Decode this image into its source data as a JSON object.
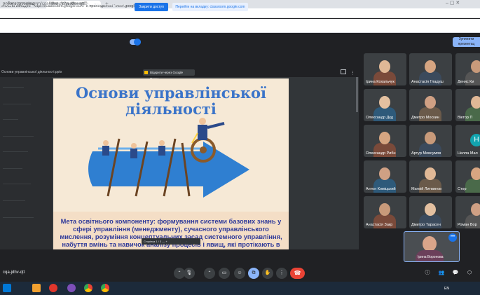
{
  "browser": {
    "tabs": [
      {
        "label": "робота для курсу"
      },
      {
        "label": "Meet. \"cqa-jdhv-qtt\""
      }
    ],
    "url": "meet.google.com/cqa-jdhv-qtt?authuser=0"
  },
  "infobar": {
    "text": "спільна вкладок: \"https://classroom.google.com\" в прилюдженні \"meet.google.com\"",
    "share_label": "Закрити доступ",
    "tab_link_label": "Перейти на вкладку: classroom.google.com"
  },
  "meet": {
    "presenter": "Ірина Воронова (Ви (показуєте презентацію))",
    "sound_label": "Звук презентації",
    "stop_label": "Зупинити презентац",
    "meeting_code": "cqa-jdhv-qtt"
  },
  "presentation": {
    "file_title": "Основи управлінської діяльності.pptx",
    "drive_badge": "Відкрити через Google Презе..."
  },
  "slide": {
    "title_line1": "Основи управлінської",
    "title_line2": "діяльності",
    "body": "Мета освітнього компоненту: формування системи базових знань у сфері управління (менеджменту), сучасного управлінського мислення, розуміння концептуальних засад системного управління, набуття вмінь та навичок аналізу процесів і явищ, які протікають в",
    "page_ctrl": "Сторінка 1 / 3  —  +"
  },
  "participants": [
    {
      "name": "Ірина Кохальчук"
    },
    {
      "name": "Анастасія Гладуш"
    },
    {
      "name": "Денис Ки"
    },
    {
      "name": "Олександр Дкд"
    },
    {
      "name": "Дмитро Москин"
    },
    {
      "name": "Віктор П"
    },
    {
      "name": "Олександр Рибн"
    },
    {
      "name": "Артур Мовсумов"
    },
    {
      "name": "Нелла Мал"
    },
    {
      "name": "Антон Коміцький"
    },
    {
      "name": "Матвій Литвинов"
    },
    {
      "name": "Стор"
    },
    {
      "name": "Анастасія Закр"
    },
    {
      "name": "Дмитро Тарасен"
    },
    {
      "name": "Роман Вор"
    }
  ],
  "self": {
    "name": "Ірина Воронова"
  },
  "tray": {
    "lang": "EN"
  },
  "colors": {
    "accent": "#1a73e8",
    "end_call": "#ea4335",
    "slide_bg": "#f6e9d6",
    "slide_title": "#3b74c9"
  }
}
